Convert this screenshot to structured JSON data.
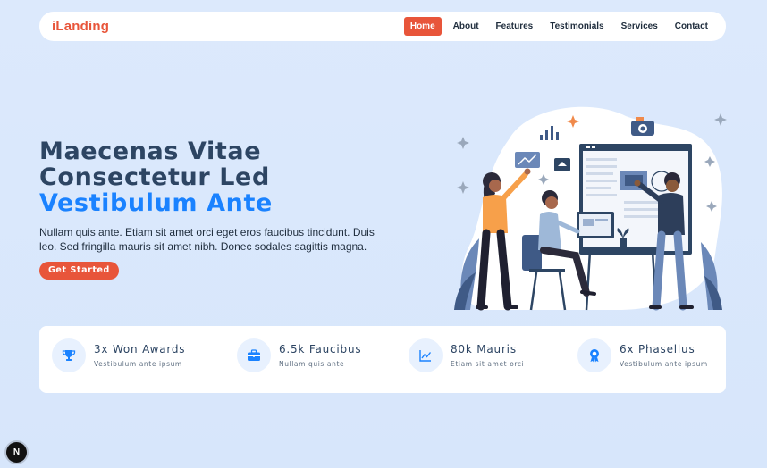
{
  "brand": {
    "name": "iLanding",
    "color": "#e8553a"
  },
  "nav": {
    "items": [
      {
        "label": "Home",
        "active": true
      },
      {
        "label": "About",
        "active": false
      },
      {
        "label": "Features",
        "active": false
      },
      {
        "label": "Testimonials",
        "active": false
      },
      {
        "label": "Services",
        "active": false
      },
      {
        "label": "Contact",
        "active": false
      }
    ]
  },
  "hero": {
    "title_line1": "Maecenas Vitae",
    "title_line2": "Consectetur Led",
    "title_accent": "Vestibulum Ante",
    "description": "Nullam quis ante. Etiam sit amet orci eget eros faucibus tincidunt. Duis leo. Sed fringilla mauris sit amet nibh. Donec sodales sagittis magna.",
    "cta_label": "Get Started"
  },
  "stats": [
    {
      "icon": "trophy-icon",
      "title": "3x Won Awards",
      "subtitle": "Vestibulum ante ipsum"
    },
    {
      "icon": "briefcase-icon",
      "title": "6.5k Faucibus",
      "subtitle": "Nullam quis ante"
    },
    {
      "icon": "graph-up-icon",
      "title": "80k Mauris",
      "subtitle": "Etiam sit amet orci"
    },
    {
      "icon": "award-icon",
      "title": "6x Phasellus",
      "subtitle": "Vestibulum ante ipsum"
    }
  ],
  "badge": {
    "label": "N"
  },
  "colors": {
    "accent": "#1a82ff",
    "cta": "#e8553a",
    "background": "#dce9fc"
  }
}
